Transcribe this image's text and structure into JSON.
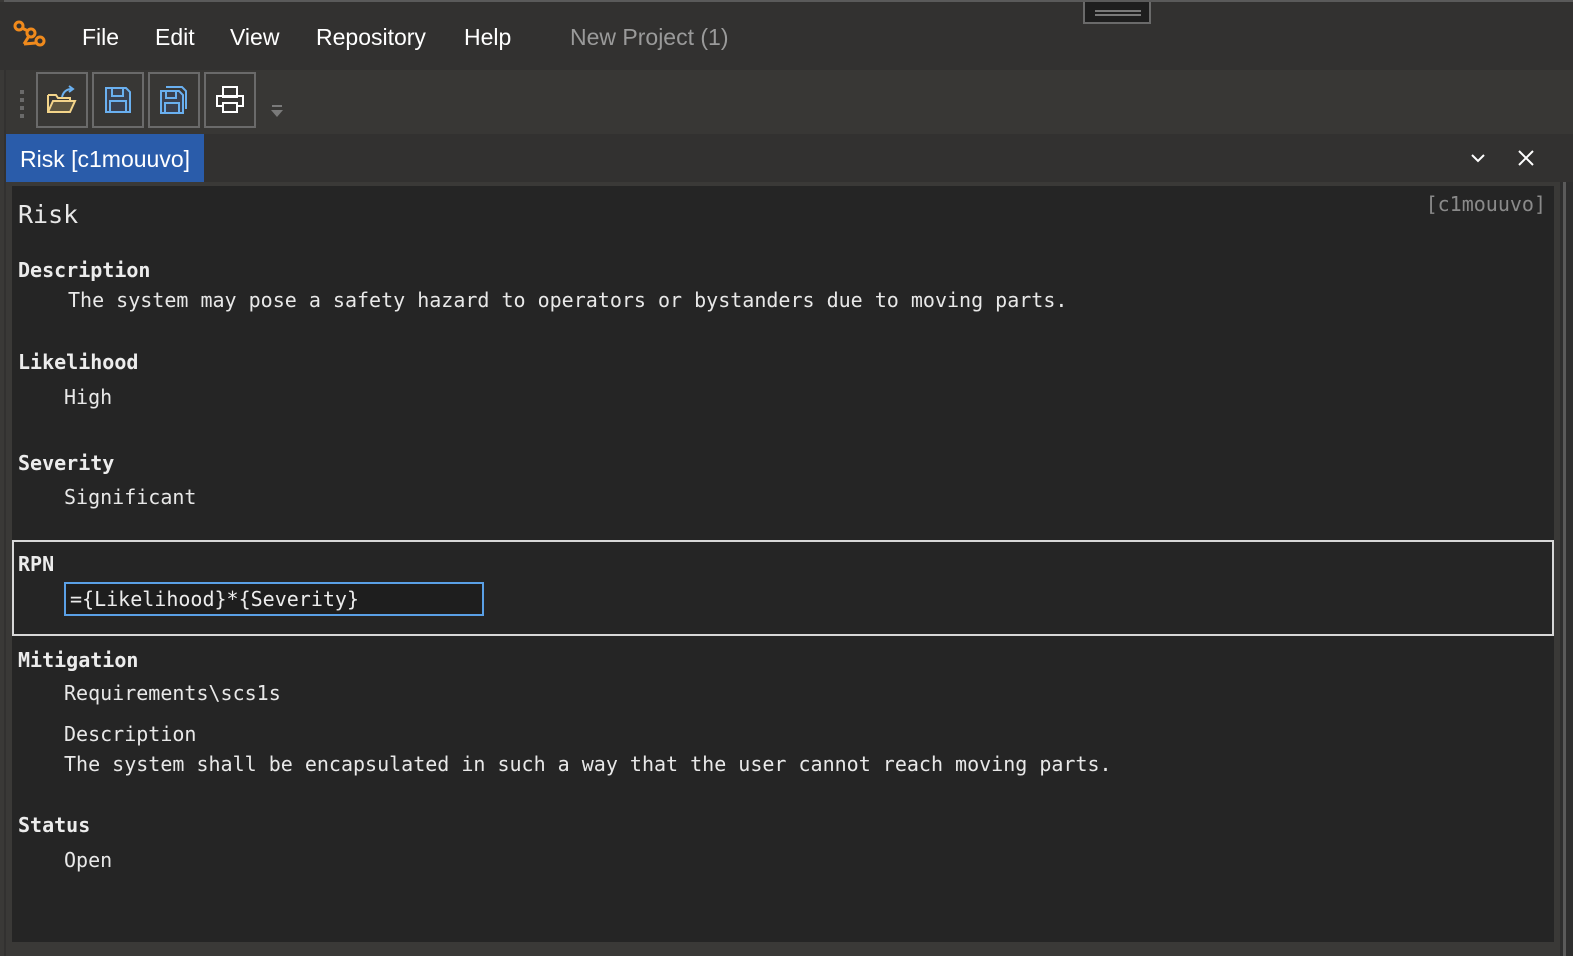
{
  "app": {
    "logo": "app-logo-icon",
    "menu": [
      "File",
      "Edit",
      "View",
      "Repository",
      "Help"
    ],
    "project_title": "New Project (1)"
  },
  "toolbar": {
    "buttons": [
      {
        "name": "open",
        "icon": "folder-open-icon"
      },
      {
        "name": "save",
        "icon": "save-icon"
      },
      {
        "name": "save-all",
        "icon": "save-all-icon"
      },
      {
        "name": "print",
        "icon": "printer-icon"
      }
    ],
    "overflow_icon": "overflow-chevron-icon"
  },
  "tabs": {
    "active_label": "Risk [c1mouuvo]",
    "controls": {
      "dropdown_icon": "chevron-down-icon",
      "close_icon": "close-icon"
    },
    "accent": "#2a5caa"
  },
  "document": {
    "id_label": "[c1mouuvo]",
    "title": "Risk",
    "fields": {
      "description": {
        "label": "Description",
        "value": "The system may pose a safety hazard to operators or bystanders due to moving parts."
      },
      "likelihood": {
        "label": "Likelihood",
        "value": "High"
      },
      "severity": {
        "label": "Severity",
        "value": "Significant"
      },
      "rpn": {
        "label": "RPN",
        "value": "={Likelihood}*{Severity}"
      },
      "mitigation": {
        "label": "Mitigation",
        "link": "Requirements\\scs1s",
        "sub_label": "Description",
        "sub_value": "The system shall be encapsulated in such a way that the user cannot reach moving parts."
      },
      "status": {
        "label": "Status",
        "value": "Open"
      }
    }
  }
}
